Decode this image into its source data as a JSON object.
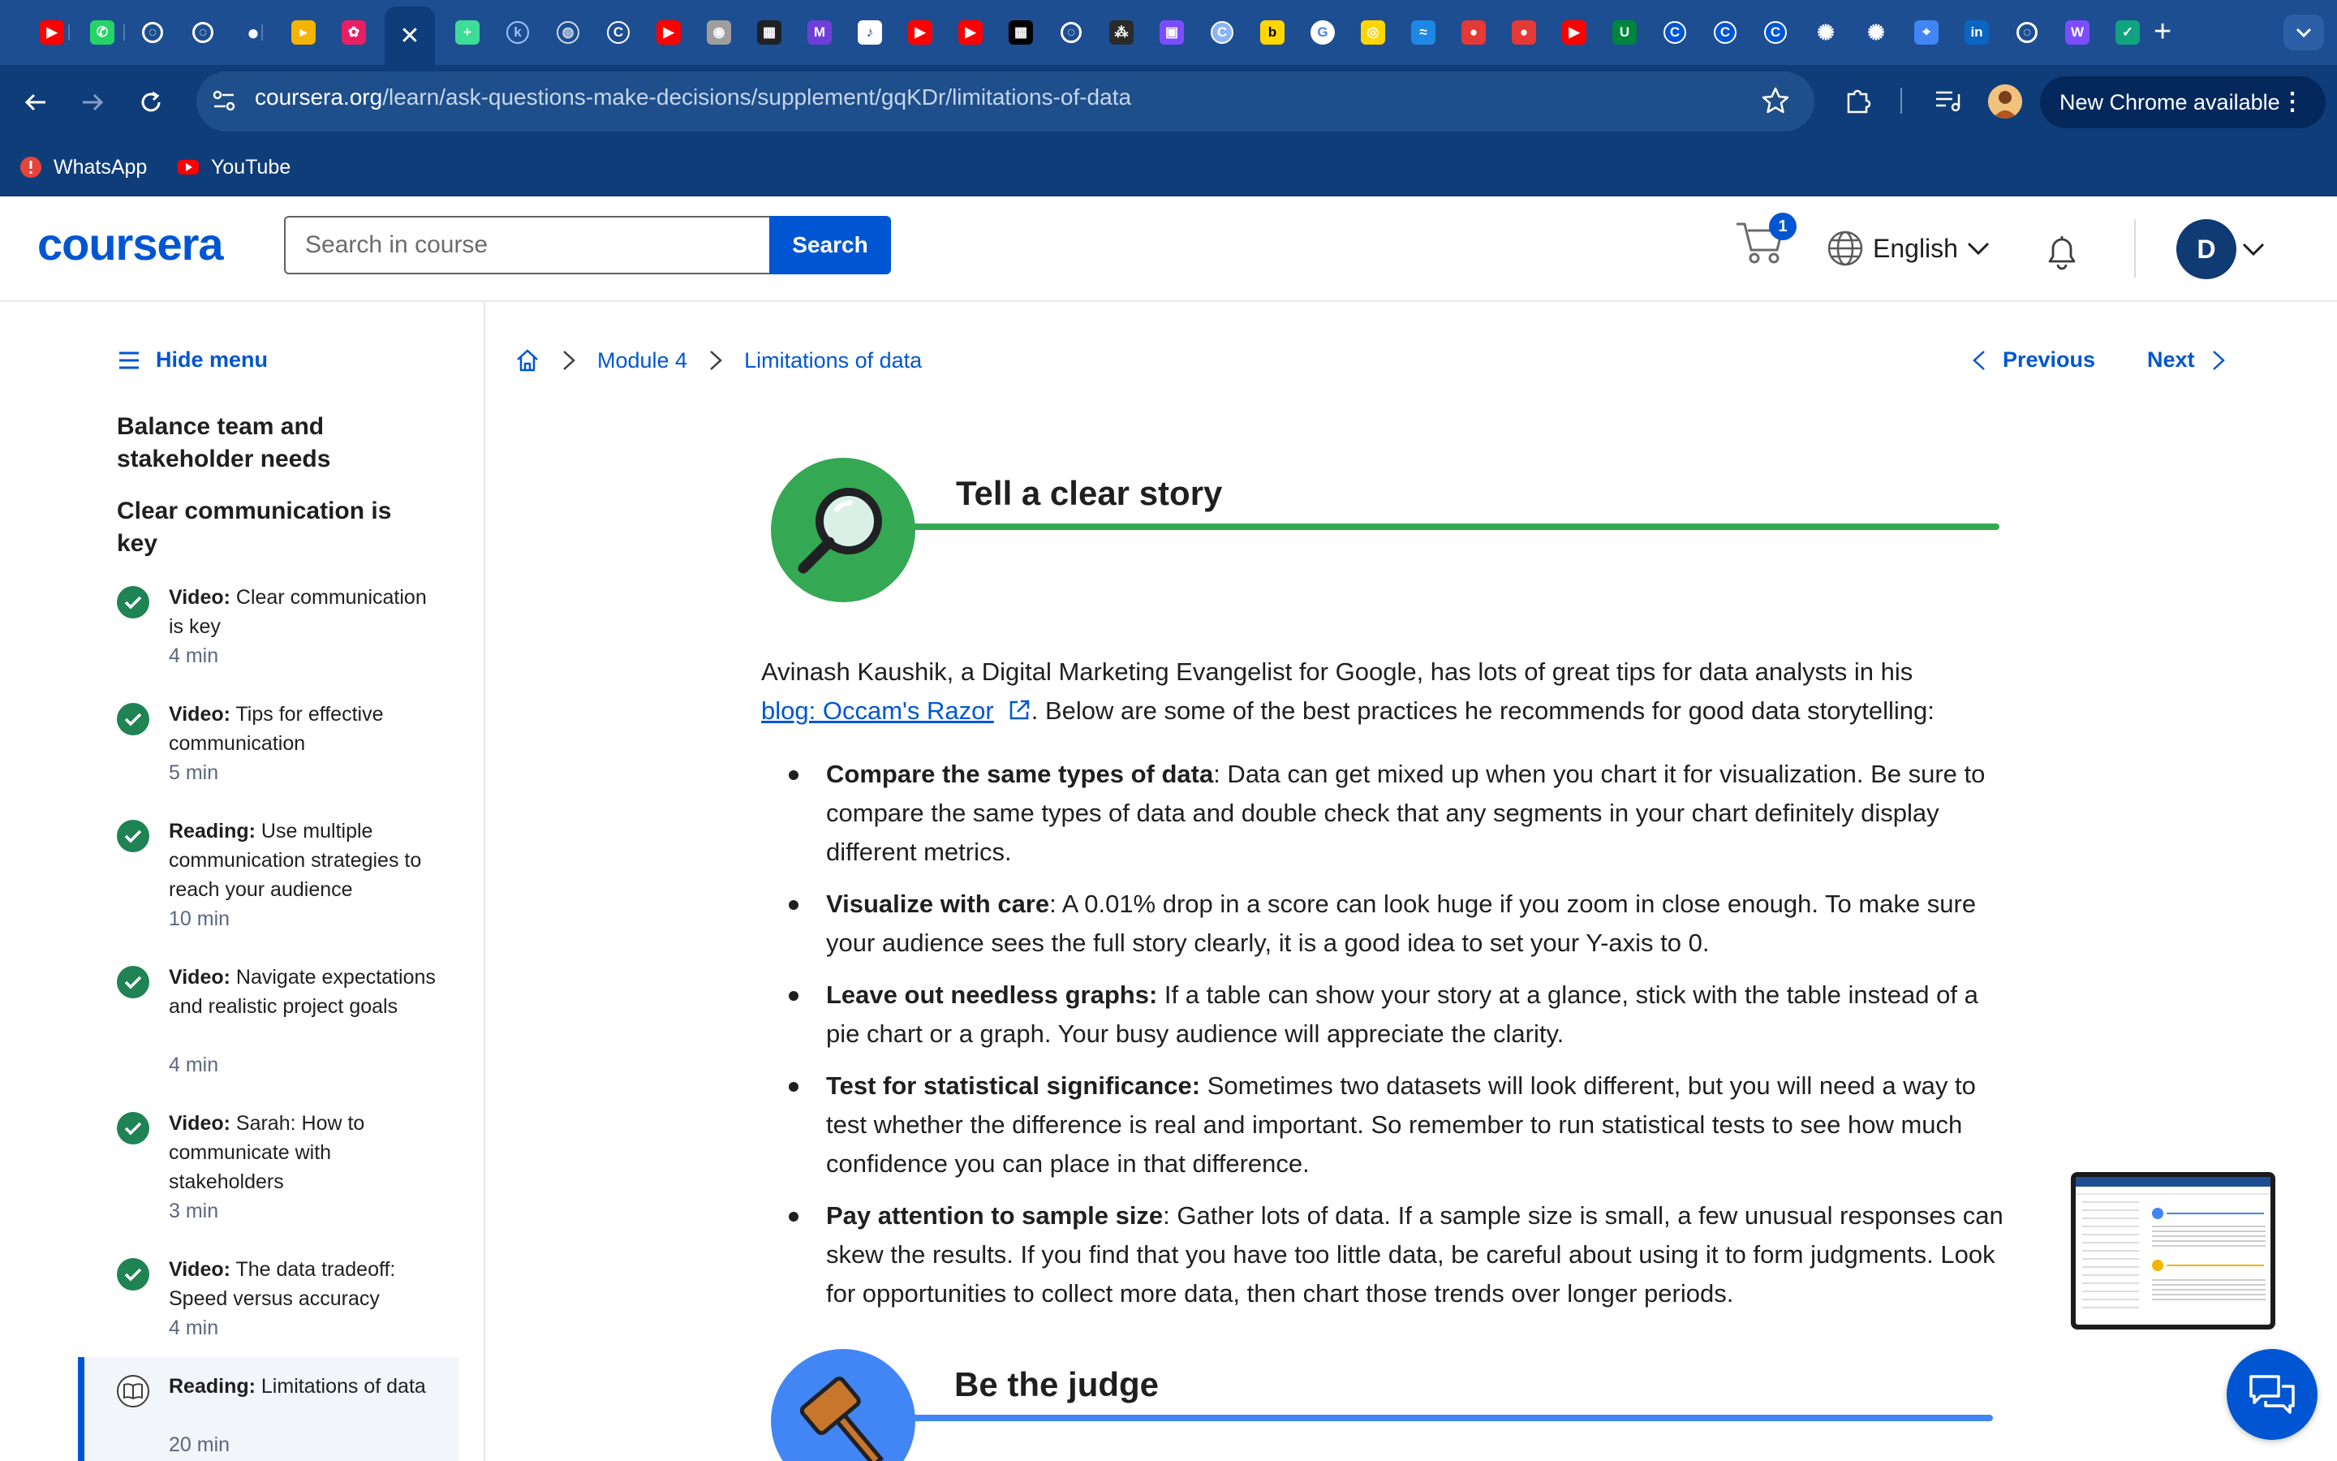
{
  "browser": {
    "tabs": [
      {
        "icon": "youtube-icon",
        "color": "#ff0000"
      },
      {
        "icon": "whatsapp-icon",
        "color": "#25d366"
      },
      {
        "icon": "loading-icon",
        "color": "#ffffff"
      },
      {
        "icon": "loading-icon",
        "color": "#ffffff"
      },
      {
        "icon": "github-icon",
        "color": "#ffffff"
      },
      {
        "icon": "slides-icon",
        "color": "#f4b400"
      },
      {
        "icon": "pink-icon",
        "color": "#e91e63"
      },
      {
        "icon": "active-tab",
        "color": "#0f3d79"
      },
      {
        "icon": "plus-circle-icon",
        "color": "#3ddc97"
      },
      {
        "icon": "k-icon",
        "color": "#9ec1ff"
      },
      {
        "icon": "globe-icon",
        "color": "#cfd8e3"
      },
      {
        "icon": "c-icon",
        "color": "#ffffff"
      },
      {
        "icon": "youtube-icon",
        "color": "#ff0000"
      },
      {
        "icon": "gray-icon",
        "color": "#9e9e9e"
      },
      {
        "icon": "dark-icon",
        "color": "#202124"
      },
      {
        "icon": "m-icon",
        "color": "#6e3fd8"
      },
      {
        "icon": "speaker-icon",
        "color": "#ffffff"
      },
      {
        "icon": "youtube-icon",
        "color": "#ff0000"
      },
      {
        "icon": "youtube-icon",
        "color": "#ff0000"
      },
      {
        "icon": "dark-icon",
        "color": "#000000"
      },
      {
        "icon": "loading-icon",
        "color": "#ffffff"
      },
      {
        "icon": "dots-icon",
        "color": "#2a2a2a"
      },
      {
        "icon": "camera-icon",
        "color": "#7c4dff"
      },
      {
        "icon": "c-icon",
        "color": "#8ab4f8"
      },
      {
        "icon": "b-icon",
        "color": "#ffd600"
      },
      {
        "icon": "google-icon",
        "color": "#ffffff"
      },
      {
        "icon": "circle-icon",
        "color": "#ffd600"
      },
      {
        "icon": "wave-icon",
        "color": "#1e88e5"
      },
      {
        "icon": "red-ball-icon",
        "color": "#e53935"
      },
      {
        "icon": "red-ball-icon",
        "color": "#e53935"
      },
      {
        "icon": "youtube-icon",
        "color": "#ff0000"
      },
      {
        "icon": "myunt-icon",
        "color": "#00853e"
      },
      {
        "icon": "c-icon",
        "color": "#0056d2"
      },
      {
        "icon": "c-icon",
        "color": "#0056d2"
      },
      {
        "icon": "c-icon",
        "color": "#0056d2"
      },
      {
        "icon": "openai-icon",
        "color": "#ffffff"
      },
      {
        "icon": "openai-icon",
        "color": "#ffffff"
      },
      {
        "icon": "maps-icon",
        "color": "#4285f4"
      },
      {
        "icon": "linkedin-icon",
        "color": "#0a66c2"
      },
      {
        "icon": "loading-icon",
        "color": "#ffffff"
      },
      {
        "icon": "w-icon",
        "color": "#7c4dff"
      },
      {
        "icon": "green-icon",
        "color": "#10a37f"
      }
    ],
    "url_host": "coursera.org",
    "url_path": "/learn/ask-questions-make-decisions/supplement/gqKDr/limitations-of-data",
    "update_label": "New Chrome available",
    "bookmarks": [
      {
        "label": "WhatsApp",
        "icon": "warning-icon"
      },
      {
        "label": "YouTube",
        "icon": "youtube-icon"
      }
    ]
  },
  "header": {
    "logo": "coursera",
    "search_placeholder": "Search in course",
    "search_button": "Search",
    "cart_count": "1",
    "language": "English",
    "avatar_initial": "D"
  },
  "sidebar": {
    "hide_menu": "Hide menu",
    "section1": "Balance team and stakeholder needs",
    "section2": "Clear communication is key",
    "items": [
      {
        "type": "Video:",
        "title": "Clear communication is key",
        "duration": "4 min",
        "done": true
      },
      {
        "type": "Video:",
        "title": "Tips for effective communication",
        "duration": "5 min",
        "done": true
      },
      {
        "type": "Reading:",
        "title": "Use multiple communication strategies to reach your audience",
        "duration": "10 min",
        "done": true
      },
      {
        "type": "Video:",
        "title": "Navigate expectations and realistic project goals",
        "duration": "4 min",
        "done": true
      },
      {
        "type": "Video:",
        "title": "Sarah: How to communicate with stakeholders",
        "duration": "3 min",
        "done": true
      },
      {
        "type": "Video:",
        "title": "The data tradeoff: Speed versus accuracy",
        "duration": "4 min",
        "done": true
      },
      {
        "type": "Reading:",
        "title": "Limitations of data",
        "duration": "20 min",
        "done": false
      }
    ]
  },
  "main": {
    "breadcrumb": [
      "Module 4",
      "Limitations of data"
    ],
    "previous": "Previous",
    "next": "Next",
    "section1_title": "Tell a clear story",
    "section2_title": "Be the judge",
    "intro_before": "Avinash Kaushik, a Digital Marketing Evangelist for Google, has lots of great tips for data analysts in his",
    "intro_link": "blog: Occam's Razor",
    "intro_after": ". Below are some of the best practices he recommends for good data storytelling:",
    "bullets": [
      {
        "bold": "Compare the same types of data",
        "text": ": Data can get mixed up when you chart it for visualization. Be sure to compare the same types of data and double check that any segments in your chart definitely display different metrics."
      },
      {
        "bold": "Visualize with care",
        "text": ": A 0.01% drop in a score can look huge if you zoom in close enough. To make sure your audience sees the full story clearly, it is a good idea to set your Y-axis to 0."
      },
      {
        "bold": "Leave out needless graphs:",
        "text": " If a table can show your story at a glance, stick with the table instead of a pie chart or a graph. Your busy audience will appreciate the clarity."
      },
      {
        "bold": "Test for statistical significance:",
        "text": " Sometimes two datasets will look different, but you will need a way to test whether the difference is real and important. So remember to run statistical tests to see how much confidence you can place in that difference."
      },
      {
        "bold": "Pay attention to sample size",
        "text": ": Gather lots of data. If a sample size is small, a few unusual responses can skew the results. If you find that you have too little data, be careful about using it to form judgments. Look for opportunities to collect more data, then chart those trends over longer periods."
      }
    ]
  },
  "colors": {
    "accent": "#0056d2",
    "green_section": "#34a853",
    "blue_section": "#4285f4",
    "completed": "#1f8354"
  }
}
